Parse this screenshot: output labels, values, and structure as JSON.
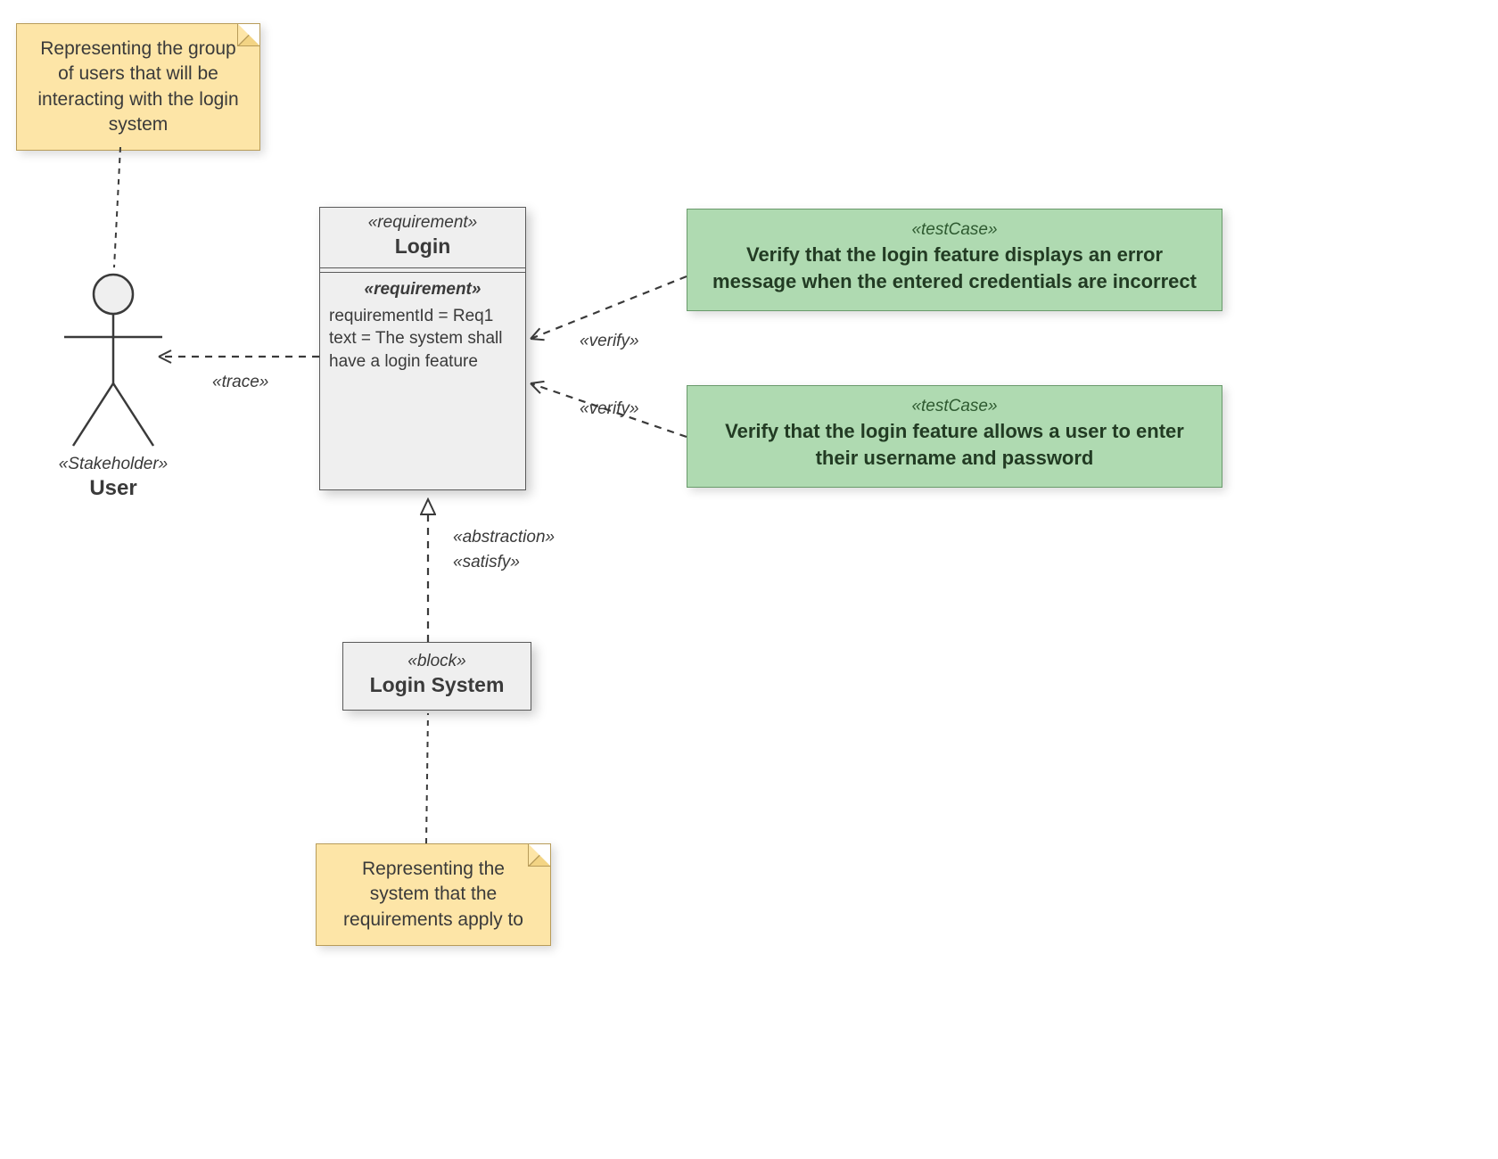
{
  "notes": {
    "user_note": "Representing the group of users that will be interacting with the login system",
    "system_note": "Representing the system that the requirements apply to"
  },
  "actor": {
    "stereotype": "«Stakeholder»",
    "name": "User"
  },
  "requirement": {
    "header_stereotype": "«requirement»",
    "header_name": "Login",
    "body_stereotype": "«requirement»",
    "line1": "requirementId = Req1",
    "line2": "text = The system shall have a login feature"
  },
  "block": {
    "stereotype": "«block»",
    "name": "Login System"
  },
  "testcases": {
    "tc1_stereo": "«testCase»",
    "tc1_body": "Verify that the login feature displays an error message when the entered credentials are incorrect",
    "tc2_stereo": "«testCase»",
    "tc2_body": "Verify that the login feature allows a user to enter their username and password"
  },
  "edges": {
    "trace": "«trace»",
    "verify": "«verify»",
    "abstraction": "«abstraction»",
    "satisfy": "«satisfy»"
  }
}
